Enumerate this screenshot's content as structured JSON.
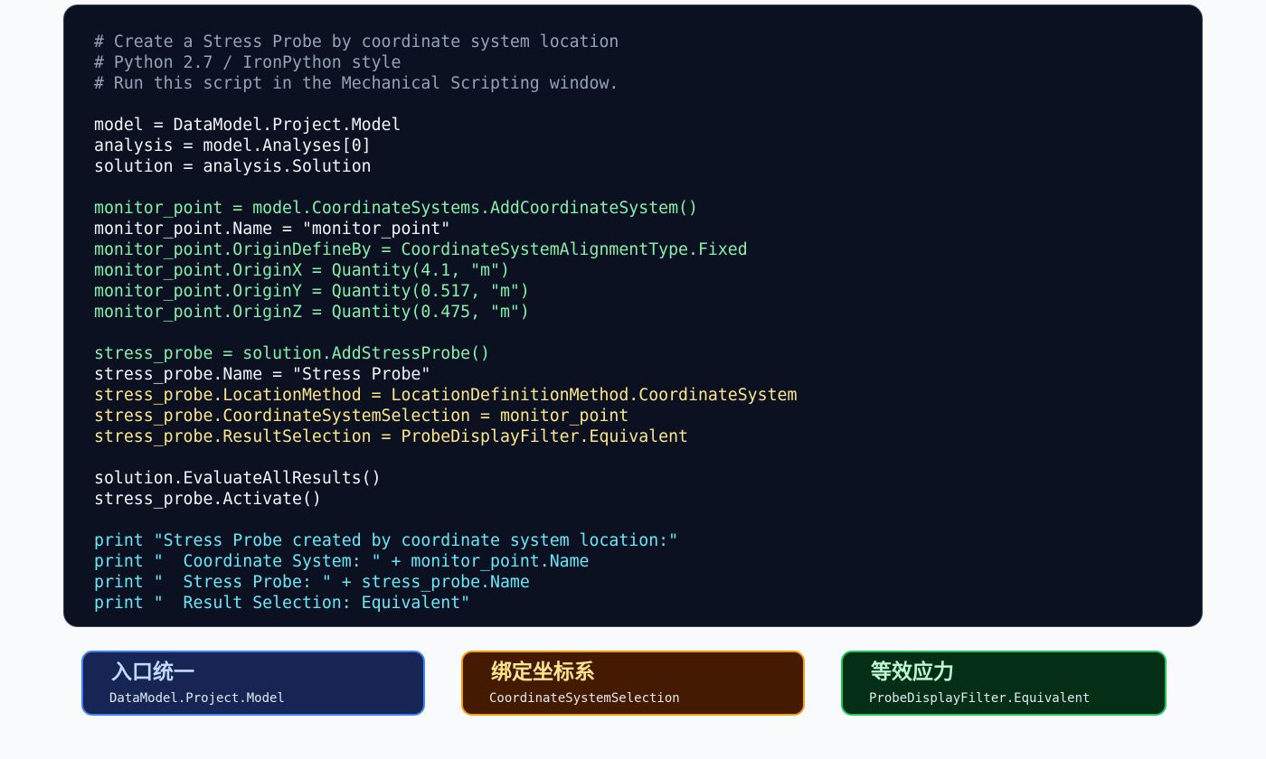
{
  "editor": {
    "lines": [
      {
        "text": "# Create a Stress Probe by coordinate system location",
        "tone": "comment"
      },
      {
        "text": "# Python 2.7 / IronPython style",
        "tone": "comment"
      },
      {
        "text": "# Run this script in the Mechanical Scripting window.",
        "tone": "comment"
      },
      {
        "text": "",
        "tone": "plain"
      },
      {
        "text": "model = DataModel.Project.Model",
        "tone": "plain"
      },
      {
        "text": "analysis = model.Analyses[0]",
        "tone": "plain"
      },
      {
        "text": "solution = analysis.Solution",
        "tone": "plain"
      },
      {
        "text": "",
        "tone": "plain"
      },
      {
        "text": "monitor_point = model.CoordinateSystems.AddCoordinateSystem()",
        "tone": "green"
      },
      {
        "text": "monitor_point.Name = \"monitor_point\"",
        "tone": "plain"
      },
      {
        "text": "monitor_point.OriginDefineBy = CoordinateSystemAlignmentType.Fixed",
        "tone": "green"
      },
      {
        "text": "monitor_point.OriginX = Quantity(4.1, \"m\")",
        "tone": "green"
      },
      {
        "text": "monitor_point.OriginY = Quantity(0.517, \"m\")",
        "tone": "green"
      },
      {
        "text": "monitor_point.OriginZ = Quantity(0.475, \"m\")",
        "tone": "green"
      },
      {
        "text": "",
        "tone": "plain"
      },
      {
        "text": "stress_probe = solution.AddStressProbe()",
        "tone": "green"
      },
      {
        "text": "stress_probe.Name = \"Stress Probe\"",
        "tone": "plain"
      },
      {
        "text": "stress_probe.LocationMethod = LocationDefinitionMethod.CoordinateSystem",
        "tone": "yellow"
      },
      {
        "text": "stress_probe.CoordinateSystemSelection = monitor_point",
        "tone": "yellow"
      },
      {
        "text": "stress_probe.ResultSelection = ProbeDisplayFilter.Equivalent",
        "tone": "yellow"
      },
      {
        "text": "",
        "tone": "plain"
      },
      {
        "text": "solution.EvaluateAllResults()",
        "tone": "plain"
      },
      {
        "text": "stress_probe.Activate()",
        "tone": "plain"
      },
      {
        "text": "",
        "tone": "plain"
      },
      {
        "text": "print \"Stress Probe created by coordinate system location:\"",
        "tone": "cyan"
      },
      {
        "text": "print \"  Coordinate System: \" + monitor_point.Name",
        "tone": "cyan"
      },
      {
        "text": "print \"  Stress Probe: \" + stress_probe.Name",
        "tone": "cyan"
      },
      {
        "text": "print \"  Result Selection: Equivalent\"",
        "tone": "cyan"
      }
    ]
  },
  "cards": [
    {
      "title": "入口统一",
      "subtitle": "DataModel.Project.Model",
      "accent": "#3b82f6"
    },
    {
      "title": "绑定坐标系",
      "subtitle": "CoordinateSystemSelection",
      "accent": "#f59e0b"
    },
    {
      "title": "等效应力",
      "subtitle": "ProbeDisplayFilter.Equivalent",
      "accent": "#22c55e"
    }
  ],
  "colors": {
    "background": "#f8fafc",
    "editor_bg": "#0b1120",
    "comment": "#94a3b8",
    "plain": "#f1f5f9",
    "green": "#86efac",
    "yellow": "#fde68a",
    "cyan": "#67e8f9"
  }
}
